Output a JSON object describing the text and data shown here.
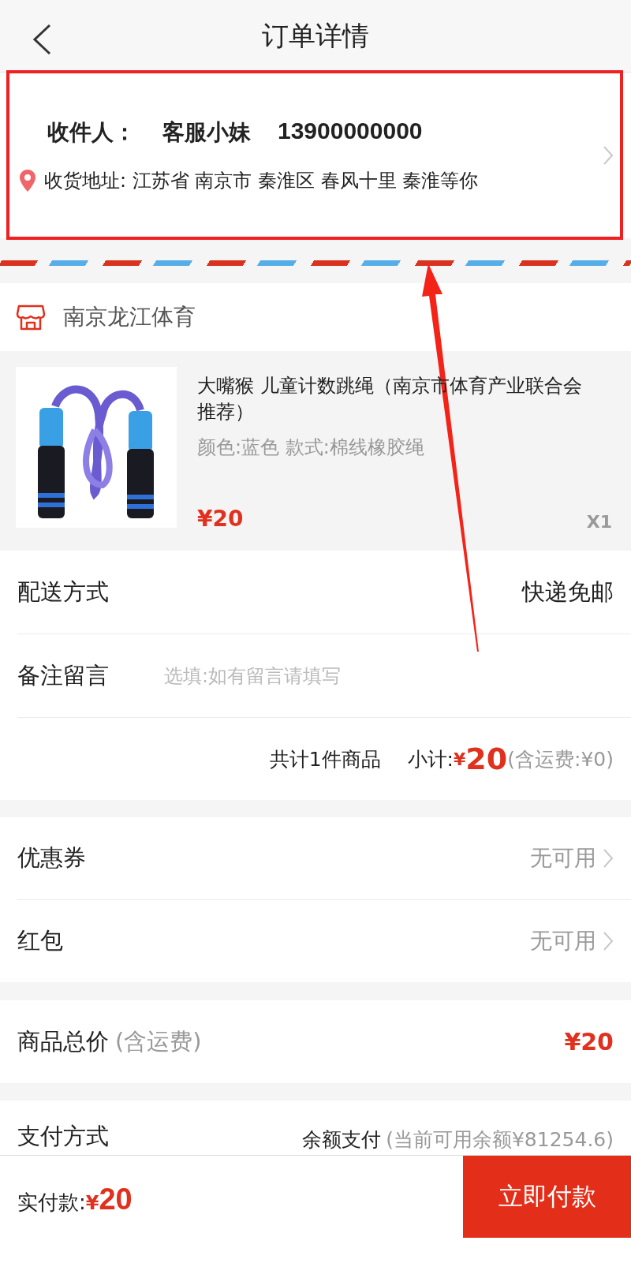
{
  "header": {
    "title": "订单详情"
  },
  "address": {
    "recipient_label": "收件人：",
    "name": "客服小妹",
    "phone": "13900000000",
    "address_label": "收货地址:",
    "address": "江苏省 南京市 秦淮区 春风十里 秦淮等你"
  },
  "shop": {
    "name": "南京龙江体育"
  },
  "product": {
    "kind": "picture",
    "title": "大嘴猴 儿童计数跳绳（南京市体育产业联合会推荐）",
    "spec": "颜色:蓝色 款式:棉线橡胶绳",
    "price": "¥20",
    "quantity": "X1"
  },
  "order_rows": [
    {
      "kind": "value",
      "label": "配送方式",
      "value": "快递免邮"
    },
    {
      "kind": "input",
      "label": "备注留言",
      "placeholder": "选填:如有留言请填写"
    }
  ],
  "summary": {
    "count_text": "共计1件商品",
    "subtotal_label": "小计:",
    "currency": "¥",
    "amount": "20",
    "shipping": "(含运费:¥0)"
  },
  "discounts": [
    {
      "label": "优惠券",
      "value": "无可用"
    },
    {
      "label": "红包",
      "value": "无可用"
    }
  ],
  "total": {
    "label": "商品总价",
    "note": "(含运费)",
    "value": "¥20"
  },
  "payment": {
    "label": "支付方式",
    "method": "余额支付",
    "balance": "(当前可用余额¥81254.6)"
  },
  "bottom_bar": {
    "label": "实付款:",
    "currency": "¥",
    "amount": "20",
    "pay_button": "立即付款"
  }
}
